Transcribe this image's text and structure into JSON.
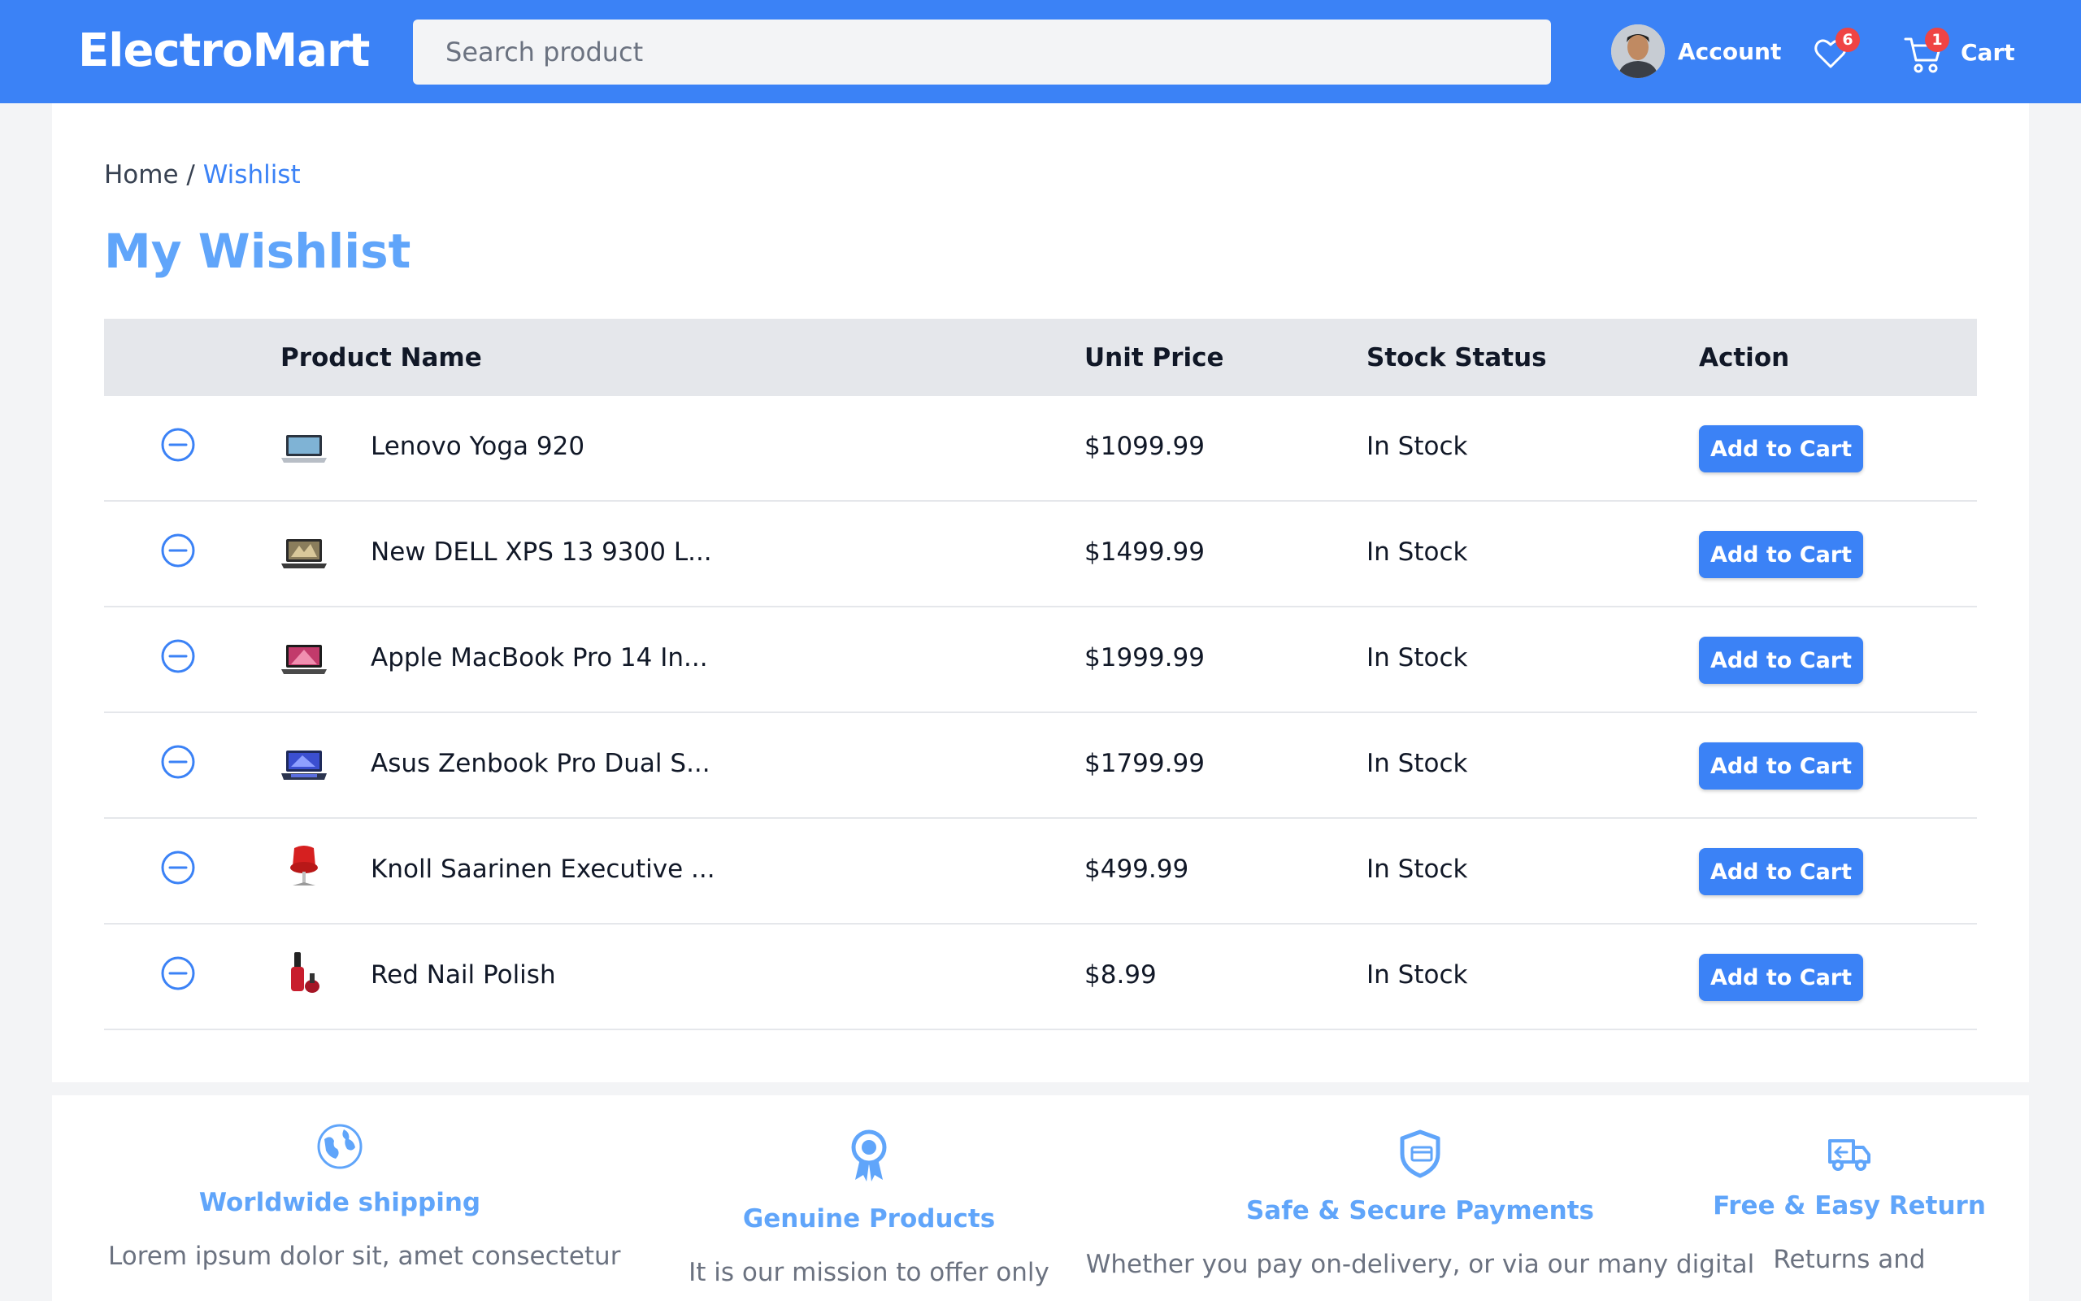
{
  "header": {
    "logo": "ElectroMart",
    "search_placeholder": "Search product",
    "account_label": "Account",
    "wishlist_count": "6",
    "cart_count": "1",
    "cart_label": "Cart"
  },
  "breadcrumb": {
    "home": "Home",
    "separator": " / ",
    "current": "Wishlist"
  },
  "page_title": "My Wishlist",
  "table": {
    "headers": {
      "name": "Product Name",
      "price": "Unit Price",
      "stock": "Stock Status",
      "action": "Action"
    },
    "rows": [
      {
        "name": "Lenovo Yoga 920",
        "price": "$1099.99",
        "stock": "In Stock",
        "action": "Add to Cart",
        "thumb": "laptop-silver"
      },
      {
        "name": "New DELL XPS 13 9300 L...",
        "price": "$1499.99",
        "stock": "In Stock",
        "action": "Add to Cart",
        "thumb": "laptop-dark"
      },
      {
        "name": "Apple MacBook Pro 14 In...",
        "price": "$1999.99",
        "stock": "In Stock",
        "action": "Add to Cart",
        "thumb": "laptop-pink"
      },
      {
        "name": "Asus Zenbook Pro Dual S...",
        "price": "$1799.99",
        "stock": "In Stock",
        "action": "Add to Cart",
        "thumb": "laptop-blue"
      },
      {
        "name": "Knoll Saarinen Executive ...",
        "price": "$499.99",
        "stock": "In Stock",
        "action": "Add to Cart",
        "thumb": "red-chair"
      },
      {
        "name": "Red Nail Polish",
        "price": "$8.99",
        "stock": "In Stock",
        "action": "Add to Cart",
        "thumb": "nail-polish"
      }
    ]
  },
  "features": [
    {
      "icon": "globe-icon",
      "title": "Worldwide shipping",
      "text": "Lorem ipsum dolor sit, amet consectetur"
    },
    {
      "icon": "award-icon",
      "title": "Genuine Products",
      "text": "It is our mission to offer only"
    },
    {
      "icon": "shield-icon",
      "title": "Safe & Secure Payments",
      "text": "Whether you pay on-delivery, or via our many digital"
    },
    {
      "icon": "truck-icon",
      "title": "Free & Easy Return",
      "text": "Returns and"
    }
  ],
  "colors": {
    "primary": "#3b82f6",
    "title": "#60a5fa",
    "badge": "#ef4444",
    "header_row": "#e5e7eb"
  }
}
